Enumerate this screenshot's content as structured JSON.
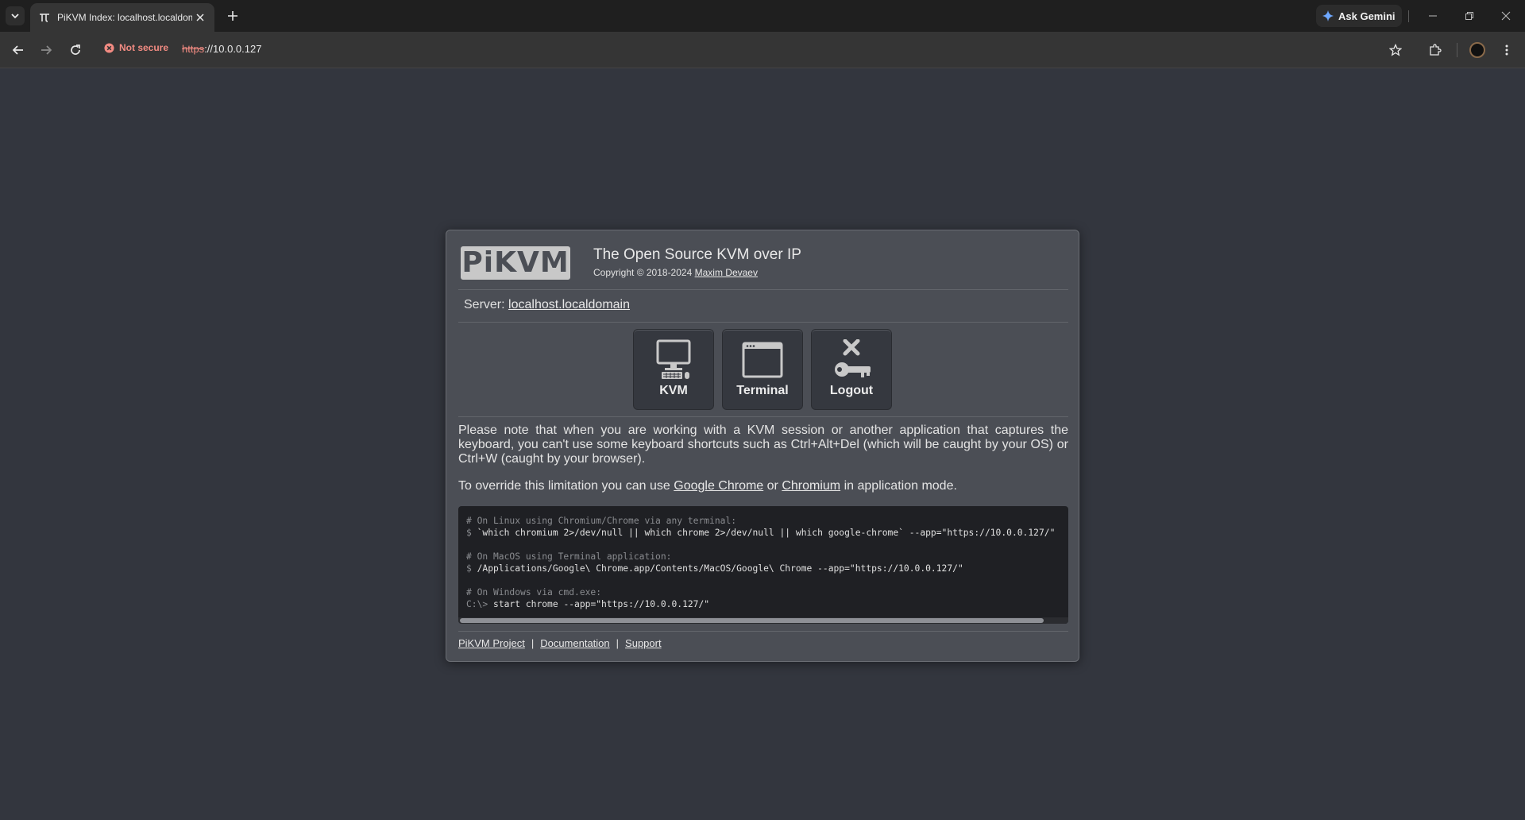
{
  "browser": {
    "tab": {
      "title": "PiKVM Index: localhost.localdomain"
    },
    "ask_gemini": "Ask Gemini",
    "security_label": "Not secure",
    "url_scheme": "https",
    "url_rest": "://10.0.0.127"
  },
  "card": {
    "logo_text": "PiKVM",
    "headline": "The Open Source KVM over IP",
    "copyright_prefix": "Copyright © 2018-2024",
    "author": "Maxim Devaev",
    "server_label": "Server:",
    "server_name": "localhost.localdomain",
    "apps": [
      {
        "label": "KVM",
        "icon": "monitor-keyboard-icon"
      },
      {
        "label": "Terminal",
        "icon": "terminal-window-icon"
      },
      {
        "label": "Logout",
        "icon": "logout-key-icon"
      }
    ],
    "note": "Please note that when you are working with a KVM session or another application that captures the keyboard, you can't use some keyboard shortcuts such as Ctrl+Alt+Del (which will be caught by your OS) or Ctrl+W (caught by your browser).",
    "override_prefix": "To override this limitation you can use",
    "override_link1": "Google Chrome",
    "override_or": "or",
    "override_link2": "Chromium",
    "override_suffix": "in application mode.",
    "code": {
      "linux_comment": "# On Linux using Chromium/Chrome via any terminal:",
      "linux_prompt": "$",
      "linux_cmd": "`which chromium 2>/dev/null || which chrome 2>/dev/null || which google-chrome` --app=\"https://10.0.0.127/\"",
      "mac_comment": "# On MacOS using Terminal application:",
      "mac_prompt": "$",
      "mac_cmd": "/Applications/Google\\ Chrome.app/Contents/MacOS/Google\\ Chrome --app=\"https://10.0.0.127/\"",
      "win_comment": "# On Windows via cmd.exe:",
      "win_prompt": "C:\\>",
      "win_cmd": "start chrome --app=\"https://10.0.0.127/\""
    },
    "footer": {
      "project": "PiKVM Project",
      "docs": "Documentation",
      "support": "Support",
      "separator": "|"
    }
  }
}
